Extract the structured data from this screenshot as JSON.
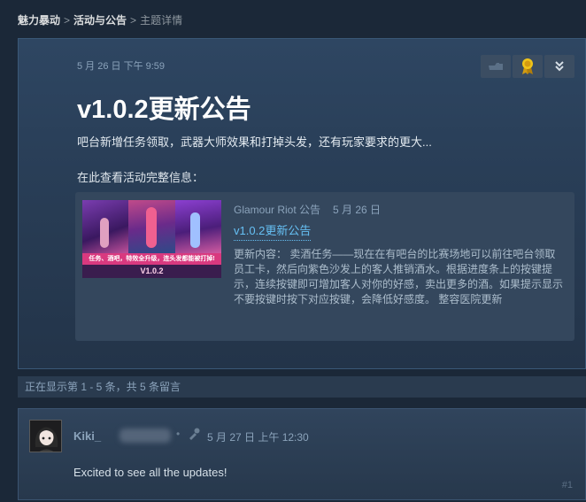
{
  "breadcrumb": {
    "items": [
      "魅力暴动",
      "活动与公告"
    ],
    "separator": ">",
    "current": "主题详情"
  },
  "topic": {
    "date": "5 月 26 日 下午 9:59",
    "title": "v1.0.2更新公告",
    "subtitle": "吧台新增任务领取，武器大师效果和打掉头发，还有玩家要求的更大...",
    "more_info_label": "在此查看活动完整信息：",
    "toolbar_icons": [
      "thumb-icon",
      "award-icon",
      "chevron-down-icon"
    ]
  },
  "card": {
    "publisher": "Glamour Riot 公告",
    "date": "5 月 26 日",
    "link_title": "v1.0.2更新公告",
    "body": "更新内容：  卖酒任务——现在在有吧台的比赛场地可以前往吧台领取员工卡，然后向紫色沙发上的客人推销酒水。根据进度条上的按键提示，连续按键即可增加客人对你的好感，卖出更多的酒。如果提示显示不要按键时按下对应按键，会降低好感度。 整容医院更新",
    "thumb_banner": "任务、酒吧，特效全升级，连头发都能被打掉!",
    "thumb_version": "V1.0.2"
  },
  "pager": {
    "text": "正在显示第 1 - 5 条，共 5 条留言"
  },
  "comment": {
    "author": "Kiki_",
    "date": "5 月 27 日 上午 12:30",
    "text": "Excited to see all the updates!",
    "number": "#1"
  },
  "colors": {
    "link": "#66c0f4",
    "title": "#ffffff",
    "award": "#f0c419"
  }
}
